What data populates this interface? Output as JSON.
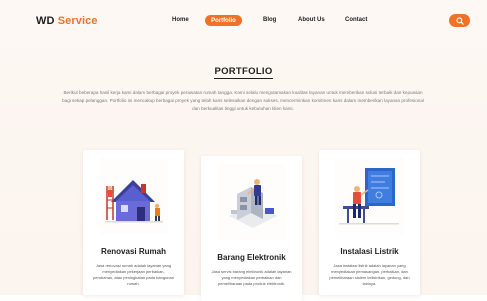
{
  "brand": {
    "part1": "WD",
    "part2": "Service"
  },
  "nav": {
    "home": "Home",
    "portfolio": "Portfolio",
    "blog": "Blog",
    "about": "About Us",
    "contact": "Contact"
  },
  "search": {
    "icon": "search-icon"
  },
  "section": {
    "title": "PORTFOLIO",
    "description": "Berikut beberapa hasil kerja kami dalam berbagai proyek perawatan rumah tangga. Kami selalu mengutamakan kualitas layanan untuk memberikan solusi terbaik dan kepuasan bagi setiap pelanggan. Portfolio ini mencakup berbagai proyek yang telah kami selesaikan dengan sukses, mencerminkan komitmen kami dalam memberikan layanan profesional dan berkualitas tinggi untuk kebutuhan klien kami."
  },
  "cards": [
    {
      "title": "Renovasi Rumah",
      "text": "Jasa renovasi rumah adalah layanan yang menyediakan pekerjaan perbaikan, perubahan, atau peningkatan pada bangunan rumah.",
      "icon": "house-renovation-icon"
    },
    {
      "title": "Barang Elektronik",
      "text": "Jasa servis barang elektronik adalah layanan yang menyediakan perbaikan dan pemeliharaan pada produk elektronik.",
      "icon": "electronics-repair-icon"
    },
    {
      "title": "Instalasi Listrik",
      "text": "Jasa instalasi listrik adalah layanan yang menyediakan pemasangan, perbaikan, dan pemeliharaan sistem kelistrikan, gedung, dan lainnya.",
      "icon": "electrical-installation-icon"
    }
  ],
  "colors": {
    "accent": "#f07227",
    "text": "#1f1f1f",
    "muted": "#7a7a7a"
  }
}
